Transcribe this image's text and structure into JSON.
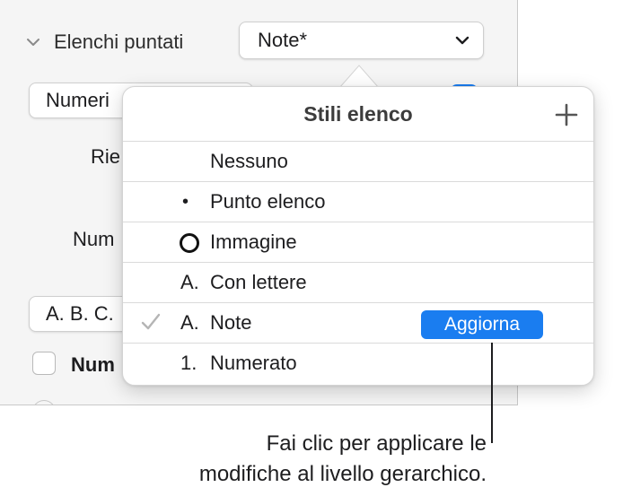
{
  "sidebar": {
    "section_title": "Elenchi puntati",
    "style_popup_value": "Note*",
    "type_popup_value": "Numeri",
    "label_indent": "Rie",
    "label_number": "Num",
    "format_popup_value": "A. B. C.",
    "checkbox_label": "Num"
  },
  "popover": {
    "title": "Stili elenco",
    "items": [
      {
        "glyph": "",
        "label": "Nessuno"
      },
      {
        "glyph": "•",
        "label": "Punto elenco"
      },
      {
        "glyph": "ring-icon",
        "label": "Immagine"
      },
      {
        "glyph": "A.",
        "label": "Con lettere"
      },
      {
        "glyph": "A.",
        "label": "Note",
        "selected": true,
        "button": "Aggiorna"
      },
      {
        "glyph": "1.",
        "label": "Numerato"
      }
    ]
  },
  "callout": {
    "line1": "Fai clic per applicare le",
    "line2": "modifiche al livello gerarchico."
  },
  "colors": {
    "accent": "#1a7df0",
    "checkmark": "#b5b5b5"
  }
}
